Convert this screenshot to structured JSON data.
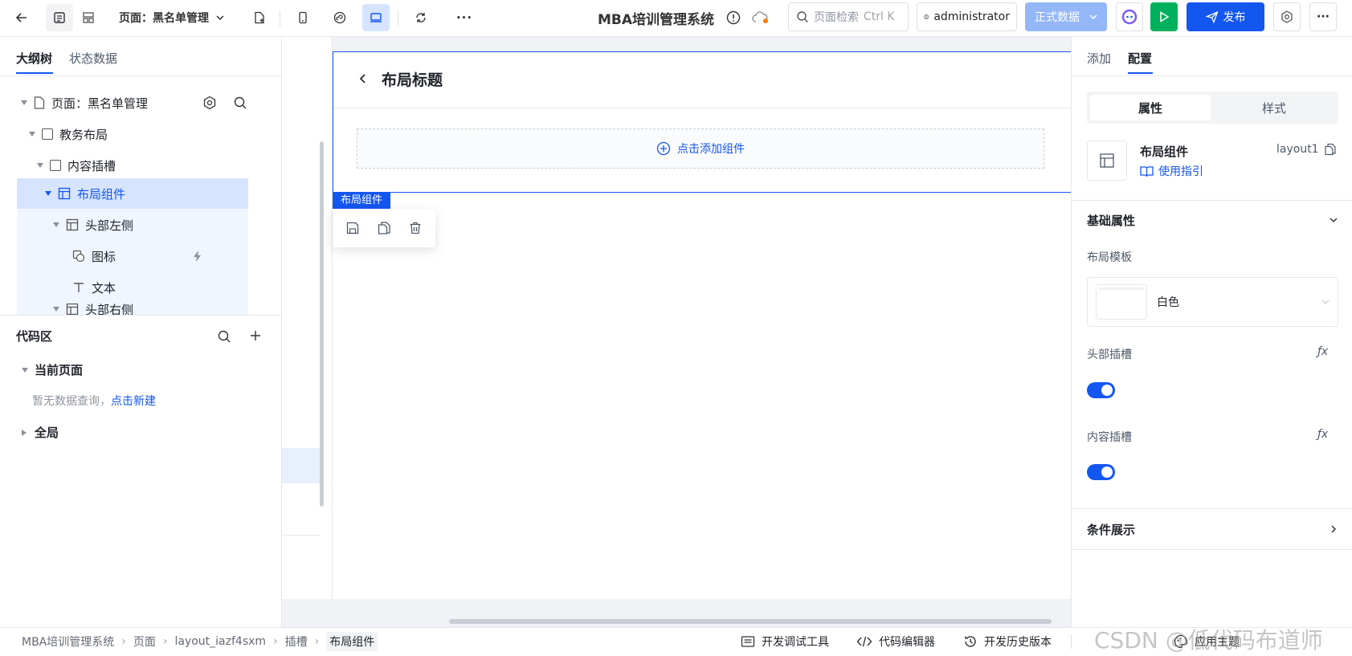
{
  "topbar": {
    "page_label": "页面：黑名单管理",
    "app_title": "MBA培训管理系统",
    "search_placeholder": "页面检索",
    "search_shortcut": "Ctrl K",
    "user": "administrator",
    "env_label": "正式数据",
    "publish_label": "发布"
  },
  "left": {
    "tabs": [
      "大纲树",
      "状态数据"
    ],
    "tree": [
      {
        "label": "页面：黑名单管理"
      },
      {
        "label": "教务布局"
      },
      {
        "label": "内容插槽"
      },
      {
        "label": "布局组件"
      },
      {
        "label": "头部左侧"
      },
      {
        "label": "图标"
      },
      {
        "label": "文本"
      },
      {
        "label": "头部右侧"
      }
    ],
    "code_title": "代码区",
    "current_page": "当前页面",
    "empty_text": "暂无数据查询，",
    "create_link": "点击新建",
    "global": "全局"
  },
  "canvas": {
    "layout_title": "布局标题",
    "add_component": "点击添加组件",
    "selected_tag": "布局组件"
  },
  "right": {
    "tabs": [
      "添加",
      "配置"
    ],
    "seg": [
      "属性",
      "样式"
    ],
    "comp_name": "布局组件",
    "comp_id": "layout1",
    "guide": "使用指引",
    "basic_props": "基础属性",
    "layout_template": "布局模板",
    "template_value": "白色",
    "header_slot": "头部插槽",
    "content_slot": "内容插槽",
    "fx": "ƒx",
    "condition": "条件展示"
  },
  "bottom": {
    "breadcrumb": [
      "MBA培训管理系统",
      "页面",
      "layout_iazf4sxm",
      "插槽",
      "布局组件"
    ],
    "tools": [
      "开发调试工具",
      "代码编辑器",
      "开发历史版本",
      "应用主题"
    ],
    "watermark": "CSDN @低代码布道师"
  },
  "colors": {
    "accent": "#1456f0",
    "selected_row": "#d6e4ff",
    "env_btn": "#94b7f7"
  }
}
